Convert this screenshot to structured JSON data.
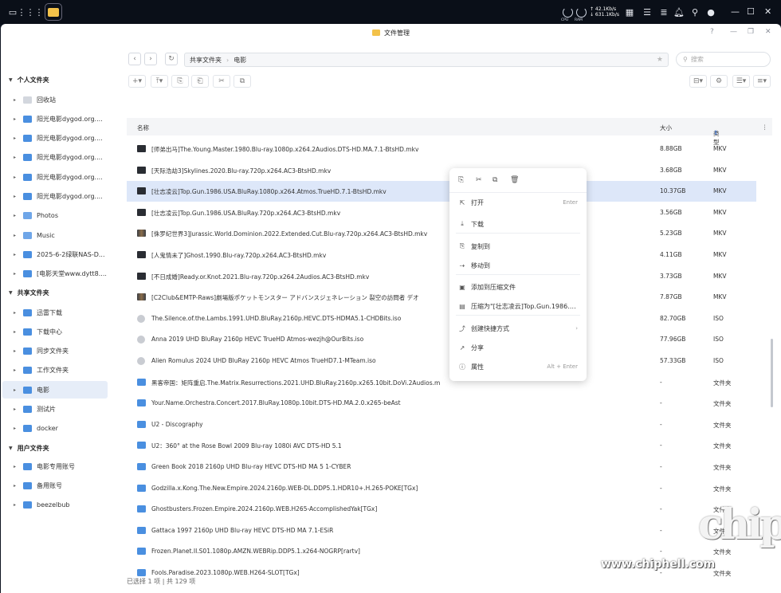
{
  "taskbar": {
    "net_gauge_1": "CPU",
    "net_gauge_2": "RAM",
    "up_speed": "↑ 42.1Kb/s",
    "down_speed": "↓ 631.1Kb/s"
  },
  "window": {
    "title": "文件管理",
    "help": "?"
  },
  "sidebar": {
    "personal_header": "个人文件夹",
    "personal_items": [
      {
        "label": "回收站",
        "icon": "trash-icon"
      },
      {
        "label": "阳光电影dygod.org....",
        "icon": "folder-icon"
      },
      {
        "label": "阳光电影dygod.org....",
        "icon": "folder-icon"
      },
      {
        "label": "阳光电影dygod.org....",
        "icon": "folder-icon"
      },
      {
        "label": "阳光电影dygod.org....",
        "icon": "folder-icon"
      },
      {
        "label": "阳光电影dygod.org....",
        "icon": "folder-icon"
      },
      {
        "label": "Photos",
        "icon": "photos-folder-icon"
      },
      {
        "label": "Music",
        "icon": "music-folder-icon"
      },
      {
        "label": "2025-6-2绿联NAS-D...",
        "icon": "folder-icon"
      },
      {
        "label": "[电影天堂www.dytt8....",
        "icon": "folder-icon"
      }
    ],
    "shared_header": "共享文件夹",
    "shared_items": [
      {
        "label": "迅雷下载",
        "icon": "folder-icon"
      },
      {
        "label": "下载中心",
        "icon": "folder-icon"
      },
      {
        "label": "同步文件夹",
        "icon": "folder-icon"
      },
      {
        "label": "工作文件夹",
        "icon": "folder-icon"
      },
      {
        "label": "电影",
        "icon": "folder-icon",
        "active": true
      },
      {
        "label": "测试片",
        "icon": "folder-icon"
      },
      {
        "label": "docker",
        "icon": "folder-icon"
      }
    ],
    "user_header": "用户文件夹",
    "user_items": [
      {
        "label": "电影专用账号",
        "icon": "folder-icon"
      },
      {
        "label": "备用账号",
        "icon": "folder-icon"
      },
      {
        "label": "beezelbub",
        "icon": "folder-icon"
      }
    ]
  },
  "path": {
    "root": "共享文件夹",
    "current": "电影"
  },
  "search": {
    "placeholder": "搜索"
  },
  "table": {
    "col_name": "名称",
    "col_size": "大小",
    "col_type": "类型",
    "rows": [
      {
        "name": "[师弟出马]The.Young.Master.1980.Blu-ray.1080p.x264.2Audios.DTS-HD.MA.7.1-BtsHD.mkv",
        "size": "8.88GB",
        "type": "MKV",
        "icon": "video"
      },
      {
        "name": "[天际浩劫3]Skylines.2020.Blu-ray.720p.x264.AC3-BtsHD.mkv",
        "size": "3.68GB",
        "type": "MKV",
        "icon": "video"
      },
      {
        "name": "[壮志凌云]Top.Gun.1986.USA.BluRay.1080p.x264.Atmos.TrueHD.7.1-BtsHD.mkv",
        "size": "10.37GB",
        "type": "MKV",
        "icon": "video",
        "selected": true
      },
      {
        "name": "[壮志凌云]Top.Gun.1986.USA.BluRay.720p.x264.AC3-BtsHD.mkv",
        "size": "3.56GB",
        "type": "MKV",
        "icon": "video"
      },
      {
        "name": "[侏罗纪世界3]Jurassic.World.Dominion.2022.Extended.Cut.Blu-ray.720p.x264.AC3-BtsHD.mkv",
        "size": "5.23GB",
        "type": "MKV",
        "icon": "video-c"
      },
      {
        "name": "[人鬼情未了]Ghost.1990.Blu-ray.720p.x264.AC3-BtsHD.mkv",
        "size": "4.11GB",
        "type": "MKV",
        "icon": "video"
      },
      {
        "name": "[不日成婚]Ready.or.Knot.2021.Blu-ray.720p.x264.2Audios.AC3-BtsHD.mkv",
        "size": "3.73GB",
        "type": "MKV",
        "icon": "video"
      },
      {
        "name": "[C2Club&EMTP-Raws]劇場版ポケットモンスター アドバンスジェネレーション 裂空の訪問者 デオ",
        "size": "7.87GB",
        "type": "MKV",
        "icon": "video-c"
      },
      {
        "name": "The.Silence.of.the.Lambs.1991.UHD.BluRay.2160p.HEVC.DTS-HDMA5.1-CHDBits.iso",
        "size": "82.70GB",
        "type": "ISO",
        "icon": "disc"
      },
      {
        "name": "Anna 2019 UHD BluRay 2160p HEVC TrueHD Atmos-wezjh@OurBits.iso",
        "size": "77.96GB",
        "type": "ISO",
        "icon": "disc"
      },
      {
        "name": "Alien Romulus 2024 UHD BluRay 2160p HEVC Atmos TrueHD7.1-MTeam.iso",
        "size": "57.33GB",
        "type": "ISO",
        "icon": "disc"
      },
      {
        "name": "黑客帝国：矩阵重启.The.Matrix.Resurrections.2021.UHD.BluRay.2160p.x265.10bit.DoVi.2Audios.m",
        "size": "-",
        "type": "文件夹",
        "icon": "dir"
      },
      {
        "name": "Your.Name.Orchestra.Concert.2017.BluRay.1080p.10bit.DTS-HD.MA.2.0.x265-beAst",
        "size": "-",
        "type": "文件夹",
        "icon": "dir"
      },
      {
        "name": "U2 - Discography",
        "size": "-",
        "type": "文件夹",
        "icon": "dir"
      },
      {
        "name": "U2：360° at the Rose Bowl 2009 Blu-ray 1080i AVC DTS-HD 5.1",
        "size": "-",
        "type": "文件夹",
        "icon": "dir"
      },
      {
        "name": "Green Book 2018 2160p UHD Blu-ray HEVC DTS-HD MA 5 1-CYBER",
        "size": "-",
        "type": "文件夹",
        "icon": "dir"
      },
      {
        "name": "Godzilla.x.Kong.The.New.Empire.2024.2160p.WEB-DL.DDP5.1.HDR10+.H.265-POKE[TGx]",
        "size": "-",
        "type": "文件夹",
        "icon": "dir"
      },
      {
        "name": "Ghostbusters.Frozen.Empire.2024.2160p.WEB.H265-AccomplishedYak[TGx]",
        "size": "-",
        "type": "文件夹",
        "icon": "dir"
      },
      {
        "name": "Gattaca 1997 2160p UHD Blu-ray HEVC DTS-HD MA 7.1-ESiR",
        "size": "-",
        "type": "文件夹",
        "icon": "dir"
      },
      {
        "name": "Frozen.Planet.II.S01.1080p.AMZN.WEBRip.DDP5.1.x264-NOGRP[rartv]",
        "size": "-",
        "type": "文件夹",
        "icon": "dir"
      },
      {
        "name": "Fools.Paradise.2023.1080p.WEB.H264-SLOT[TGx]",
        "size": "-",
        "type": "文件夹",
        "icon": "dir"
      }
    ]
  },
  "context_menu": {
    "items": [
      {
        "label": "打开",
        "shortcut": "Enter",
        "icon": "open-icon"
      },
      {
        "label": "下载",
        "shortcut": "",
        "icon": "download-icon"
      },
      {
        "label": "复制到",
        "shortcut": "",
        "icon": "copy-to-icon"
      },
      {
        "label": "移动到",
        "shortcut": "",
        "icon": "move-to-icon"
      },
      {
        "label": "添加到压缩文件",
        "shortcut": "",
        "icon": "archive-icon"
      },
      {
        "label": "压缩为\"[壮志凌云]Top.Gun.1986.USA....",
        "shortcut": "",
        "icon": "compress-icon"
      },
      {
        "label": "创建快捷方式",
        "shortcut": "›",
        "icon": "shortcut-icon"
      },
      {
        "label": "分享",
        "shortcut": "",
        "icon": "share-icon"
      },
      {
        "label": "属性",
        "shortcut": "Alt + Enter",
        "icon": "info-icon"
      }
    ]
  },
  "status": "已选择 1 项 | 共 129 项",
  "watermark": {
    "logo": "chip",
    "url": "www.chiphell.com"
  }
}
